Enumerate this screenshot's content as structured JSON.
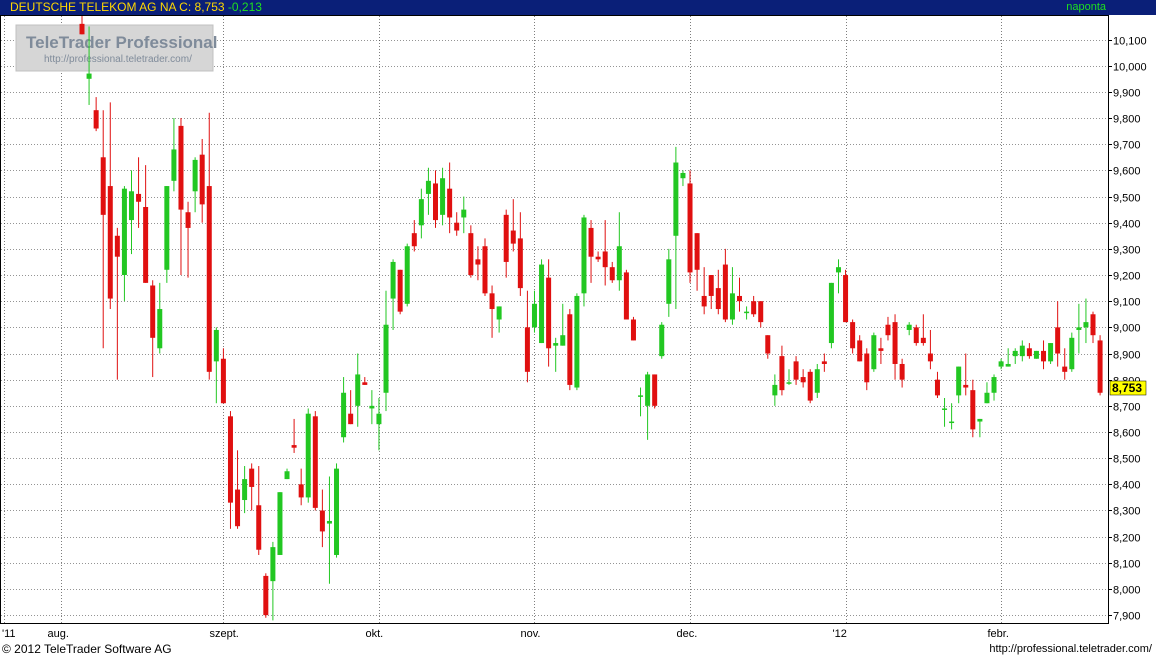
{
  "header": {
    "instrument": "DEUTSCHE TELEKOM AG NA",
    "close_label": "C:",
    "close_value": "8,753",
    "change": "-0,213",
    "period": "naponta"
  },
  "watermark": {
    "brand": "TeleTrader Professional",
    "url": "http://professional.teletrader.com/"
  },
  "last_price_badge": "8,753",
  "footer": {
    "copyright": "© 2012 TeleTrader Software AG",
    "url": "http://professional.teletrader.com/"
  },
  "colors": {
    "up": "#22c722",
    "down": "#e01010",
    "header_bg": "#0a1f78",
    "header_text": "#ffd800",
    "grid": "#2a2a2a",
    "badge": "#ffff00"
  },
  "chart_data": {
    "type": "candlestick",
    "ylim": [
      7.87,
      10.19
    ],
    "yticks": [
      7.9,
      8.0,
      8.1,
      8.2,
      8.3,
      8.4,
      8.5,
      8.6,
      8.7,
      8.8,
      8.9,
      9.0,
      9.1,
      9.2,
      9.3,
      9.4,
      9.5,
      9.6,
      9.7,
      9.8,
      9.9,
      10.0,
      10.1
    ],
    "ytick_labels": [
      "7,900",
      "8,000",
      "8,100",
      "8,200",
      "8,300",
      "8,400",
      "8,500",
      "8,600",
      "8,700",
      "8,800",
      "8,900",
      "9,000",
      "9,100",
      "9,200",
      "9,300",
      "9,400",
      "9,500",
      "9,600",
      "9,700",
      "9,800",
      "9,900",
      "10,000",
      "10,100"
    ],
    "xticks": [
      {
        "label": "'11",
        "index": -11
      },
      {
        "label": "aug.",
        "index": -3
      },
      {
        "label": "szept.",
        "index": 20
      },
      {
        "label": "okt.",
        "index": 42
      },
      {
        "label": "nov.",
        "index": 64
      },
      {
        "label": "dec.",
        "index": 86
      },
      {
        "label": "'12",
        "index": 108
      },
      {
        "label": "febr.",
        "index": 130
      }
    ],
    "candles": [
      {
        "o": 10.16,
        "h": 10.25,
        "l": 10.13,
        "c": 10.12
      },
      {
        "o": 9.95,
        "h": 10.15,
        "l": 9.85,
        "c": 9.97
      },
      {
        "o": 9.83,
        "h": 9.88,
        "l": 9.75,
        "c": 9.76
      },
      {
        "o": 9.65,
        "h": 9.83,
        "l": 8.92,
        "c": 9.43
      },
      {
        "o": 9.54,
        "h": 9.86,
        "l": 9.07,
        "c": 9.11
      },
      {
        "o": 9.35,
        "h": 9.38,
        "l": 8.8,
        "c": 9.27
      },
      {
        "o": 9.2,
        "h": 9.54,
        "l": 9.1,
        "c": 9.53
      },
      {
        "o": 9.41,
        "h": 9.6,
        "l": 9.28,
        "c": 9.52
      },
      {
        "o": 9.51,
        "h": 9.65,
        "l": 9.38,
        "c": 9.48
      },
      {
        "o": 9.46,
        "h": 9.62,
        "l": 9.17,
        "c": 9.17
      },
      {
        "o": 9.16,
        "h": 9.18,
        "l": 8.81,
        "c": 8.96
      },
      {
        "o": 8.92,
        "h": 9.17,
        "l": 8.9,
        "c": 9.07
      },
      {
        "o": 9.22,
        "h": 9.54,
        "l": 9.17,
        "c": 9.54
      },
      {
        "o": 9.56,
        "h": 9.8,
        "l": 9.52,
        "c": 9.68
      },
      {
        "o": 9.77,
        "h": 9.8,
        "l": 9.2,
        "c": 9.45
      },
      {
        "o": 9.44,
        "h": 9.48,
        "l": 9.19,
        "c": 9.38
      },
      {
        "o": 9.52,
        "h": 9.65,
        "l": 9.44,
        "c": 9.64
      },
      {
        "o": 9.66,
        "h": 9.72,
        "l": 9.4,
        "c": 9.47
      },
      {
        "o": 9.54,
        "h": 9.82,
        "l": 8.8,
        "c": 8.83
      },
      {
        "o": 8.87,
        "h": 9.0,
        "l": 8.71,
        "c": 8.99
      },
      {
        "o": 8.88,
        "h": 8.92,
        "l": 8.72,
        "c": 8.71
      },
      {
        "o": 8.66,
        "h": 8.68,
        "l": 8.23,
        "c": 8.33
      },
      {
        "o": 8.38,
        "h": 8.53,
        "l": 8.23,
        "c": 8.24
      },
      {
        "o": 8.34,
        "h": 8.47,
        "l": 8.29,
        "c": 8.42
      },
      {
        "o": 8.46,
        "h": 8.48,
        "l": 8.3,
        "c": 8.39
      },
      {
        "o": 8.32,
        "h": 8.47,
        "l": 8.13,
        "c": 8.15
      },
      {
        "o": 8.05,
        "h": 8.06,
        "l": 7.89,
        "c": 7.9
      },
      {
        "o": 8.03,
        "h": 8.18,
        "l": 7.88,
        "c": 8.16
      },
      {
        "o": 8.13,
        "h": 8.36,
        "l": 8.14,
        "c": 8.37
      },
      {
        "o": 8.42,
        "h": 8.46,
        "l": 8.42,
        "c": 8.45
      },
      {
        "o": 8.55,
        "h": 8.65,
        "l": 8.52,
        "c": 8.54
      },
      {
        "o": 8.4,
        "h": 8.46,
        "l": 8.32,
        "c": 8.35
      },
      {
        "o": 8.35,
        "h": 8.69,
        "l": 8.33,
        "c": 8.67
      },
      {
        "o": 8.66,
        "h": 8.68,
        "l": 8.3,
        "c": 8.31
      },
      {
        "o": 8.3,
        "h": 8.38,
        "l": 8.16,
        "c": 8.22
      },
      {
        "o": 8.25,
        "h": 8.43,
        "l": 8.02,
        "c": 8.26
      },
      {
        "o": 8.13,
        "h": 8.48,
        "l": 8.12,
        "c": 8.46
      },
      {
        "o": 8.58,
        "h": 8.81,
        "l": 8.56,
        "c": 8.75
      },
      {
        "o": 8.67,
        "h": 8.76,
        "l": 8.64,
        "c": 8.63
      },
      {
        "o": 8.7,
        "h": 8.9,
        "l": 8.62,
        "c": 8.82
      },
      {
        "o": 8.79,
        "h": 8.81,
        "l": 8.79,
        "c": 8.78
      },
      {
        "o": 8.69,
        "h": 8.76,
        "l": 8.63,
        "c": 8.7
      },
      {
        "o": 8.63,
        "h": 8.73,
        "l": 8.53,
        "c": 8.67
      },
      {
        "o": 8.75,
        "h": 9.14,
        "l": 8.68,
        "c": 9.01
      },
      {
        "o": 9.11,
        "h": 9.26,
        "l": 8.99,
        "c": 9.25
      },
      {
        "o": 9.22,
        "h": 9.22,
        "l": 9.05,
        "c": 9.06
      },
      {
        "o": 9.09,
        "h": 9.32,
        "l": 9.08,
        "c": 9.31
      },
      {
        "o": 9.36,
        "h": 9.41,
        "l": 9.29,
        "c": 9.31
      },
      {
        "o": 9.39,
        "h": 9.53,
        "l": 9.34,
        "c": 9.49
      },
      {
        "o": 9.51,
        "h": 9.61,
        "l": 9.43,
        "c": 9.56
      },
      {
        "o": 9.55,
        "h": 9.6,
        "l": 9.38,
        "c": 9.41
      },
      {
        "o": 9.43,
        "h": 9.61,
        "l": 9.39,
        "c": 9.57
      },
      {
        "o": 9.53,
        "h": 9.63,
        "l": 9.36,
        "c": 9.42
      },
      {
        "o": 9.4,
        "h": 9.44,
        "l": 9.35,
        "c": 9.37
      },
      {
        "o": 9.42,
        "h": 9.5,
        "l": 9.36,
        "c": 9.45
      },
      {
        "o": 9.36,
        "h": 9.39,
        "l": 9.19,
        "c": 9.2
      },
      {
        "o": 9.26,
        "h": 9.31,
        "l": 9.18,
        "c": 9.24
      },
      {
        "o": 9.31,
        "h": 9.34,
        "l": 9.12,
        "c": 9.13
      },
      {
        "o": 9.13,
        "h": 9.16,
        "l": 8.96,
        "c": 9.07
      },
      {
        "o": 9.03,
        "h": 9.08,
        "l": 8.98,
        "c": 9.08
      },
      {
        "o": 9.43,
        "h": 9.45,
        "l": 9.19,
        "c": 9.25
      },
      {
        "o": 9.37,
        "h": 9.49,
        "l": 9.29,
        "c": 9.32
      },
      {
        "o": 9.34,
        "h": 9.44,
        "l": 9.12,
        "c": 9.15
      },
      {
        "o": 9.0,
        "h": 9.14,
        "l": 8.79,
        "c": 8.83
      },
      {
        "o": 9.0,
        "h": 9.14,
        "l": 8.98,
        "c": 9.09
      },
      {
        "o": 8.94,
        "h": 9.26,
        "l": 8.94,
        "c": 9.24
      },
      {
        "o": 9.19,
        "h": 9.26,
        "l": 8.85,
        "c": 8.92
      },
      {
        "o": 8.93,
        "h": 8.96,
        "l": 8.83,
        "c": 8.94
      },
      {
        "o": 8.93,
        "h": 9.09,
        "l": 8.94,
        "c": 8.97
      },
      {
        "o": 9.05,
        "h": 9.07,
        "l": 8.76,
        "c": 8.78
      },
      {
        "o": 8.77,
        "h": 9.13,
        "l": 8.76,
        "c": 9.12
      },
      {
        "o": 9.13,
        "h": 9.43,
        "l": 9.08,
        "c": 9.42
      },
      {
        "o": 9.38,
        "h": 9.41,
        "l": 9.17,
        "c": 9.27
      },
      {
        "o": 9.27,
        "h": 9.29,
        "l": 9.25,
        "c": 9.26
      },
      {
        "o": 9.29,
        "h": 9.41,
        "l": 9.16,
        "c": 9.23
      },
      {
        "o": 9.23,
        "h": 9.25,
        "l": 9.17,
        "c": 9.18
      },
      {
        "o": 9.18,
        "h": 9.44,
        "l": 9.14,
        "c": 9.31
      },
      {
        "o": 9.21,
        "h": 9.22,
        "l": 9.03,
        "c": 9.03
      },
      {
        "o": 9.03,
        "h": 9.04,
        "l": 8.95,
        "c": 8.95
      },
      {
        "o": 8.74,
        "h": 8.77,
        "l": 8.66,
        "c": 8.74
      },
      {
        "o": 8.7,
        "h": 8.83,
        "l": 8.57,
        "c": 8.82
      },
      {
        "o": 8.82,
        "h": 8.81,
        "l": 8.69,
        "c": 8.7
      },
      {
        "o": 8.89,
        "h": 9.02,
        "l": 8.88,
        "c": 9.01
      },
      {
        "o": 9.09,
        "h": 9.3,
        "l": 9.04,
        "c": 9.26
      },
      {
        "o": 9.35,
        "h": 9.69,
        "l": 9.07,
        "c": 9.63
      },
      {
        "o": 9.57,
        "h": 9.6,
        "l": 9.54,
        "c": 9.59
      },
      {
        "o": 9.55,
        "h": 9.6,
        "l": 9.17,
        "c": 9.21
      },
      {
        "o": 9.36,
        "h": 9.36,
        "l": 9.14,
        "c": 9.22
      },
      {
        "o": 9.12,
        "h": 9.23,
        "l": 9.05,
        "c": 9.08
      },
      {
        "o": 9.2,
        "h": 9.2,
        "l": 9.07,
        "c": 9.12
      },
      {
        "o": 9.15,
        "h": 9.22,
        "l": 9.05,
        "c": 9.07
      },
      {
        "o": 9.24,
        "h": 9.3,
        "l": 9.02,
        "c": 9.03
      },
      {
        "o": 9.03,
        "h": 9.23,
        "l": 9.01,
        "c": 9.13
      },
      {
        "o": 9.12,
        "h": 9.19,
        "l": 9.06,
        "c": 9.1
      },
      {
        "o": 9.06,
        "h": 9.08,
        "l": 9.03,
        "c": 9.06
      },
      {
        "o": 9.1,
        "h": 9.12,
        "l": 9.04,
        "c": 9.05
      },
      {
        "o": 9.1,
        "h": 9.1,
        "l": 9.0,
        "c": 9.02
      },
      {
        "o": 8.97,
        "h": 8.97,
        "l": 8.88,
        "c": 8.9
      },
      {
        "o": 8.74,
        "h": 8.82,
        "l": 8.7,
        "c": 8.78
      },
      {
        "o": 8.89,
        "h": 8.93,
        "l": 8.74,
        "c": 8.76
      },
      {
        "o": 8.79,
        "h": 8.84,
        "l": 8.78,
        "c": 8.79
      },
      {
        "o": 8.87,
        "h": 8.89,
        "l": 8.78,
        "c": 8.8
      },
      {
        "o": 8.81,
        "h": 8.84,
        "l": 8.77,
        "c": 8.79
      },
      {
        "o": 8.83,
        "h": 8.84,
        "l": 8.71,
        "c": 8.72
      },
      {
        "o": 8.75,
        "h": 8.86,
        "l": 8.73,
        "c": 8.84
      },
      {
        "o": 8.87,
        "h": 8.9,
        "l": 8.83,
        "c": 8.86
      },
      {
        "o": 8.94,
        "h": 9.17,
        "l": 8.92,
        "c": 9.17
      },
      {
        "o": 9.21,
        "h": 9.26,
        "l": 9.13,
        "c": 9.23
      },
      {
        "o": 9.2,
        "h": 9.22,
        "l": 9.02,
        "c": 9.02
      },
      {
        "o": 9.02,
        "h": 9.03,
        "l": 8.9,
        "c": 8.92
      },
      {
        "o": 8.95,
        "h": 8.97,
        "l": 8.87,
        "c": 8.87
      },
      {
        "o": 8.9,
        "h": 8.92,
        "l": 8.76,
        "c": 8.79
      },
      {
        "o": 8.84,
        "h": 8.98,
        "l": 8.83,
        "c": 8.97
      },
      {
        "o": 8.92,
        "h": 8.96,
        "l": 8.86,
        "c": 8.91
      },
      {
        "o": 9.01,
        "h": 9.04,
        "l": 8.95,
        "c": 8.97
      },
      {
        "o": 9.02,
        "h": 9.05,
        "l": 8.8,
        "c": 8.86
      },
      {
        "o": 8.86,
        "h": 8.88,
        "l": 8.77,
        "c": 8.8
      },
      {
        "o": 8.99,
        "h": 9.02,
        "l": 8.97,
        "c": 9.01
      },
      {
        "o": 9.0,
        "h": 9.01,
        "l": 8.93,
        "c": 8.94
      },
      {
        "o": 8.96,
        "h": 9.05,
        "l": 8.93,
        "c": 8.94
      },
      {
        "o": 8.9,
        "h": 8.99,
        "l": 8.84,
        "c": 8.87
      },
      {
        "o": 8.8,
        "h": 8.83,
        "l": 8.73,
        "c": 8.74
      },
      {
        "o": 8.69,
        "h": 8.73,
        "l": 8.62,
        "c": 8.69
      },
      {
        "o": 8.64,
        "h": 8.71,
        "l": 8.61,
        "c": 8.64
      },
      {
        "o": 8.74,
        "h": 8.85,
        "l": 8.71,
        "c": 8.85
      },
      {
        "o": 8.78,
        "h": 8.9,
        "l": 8.74,
        "c": 8.77
      },
      {
        "o": 8.76,
        "h": 8.8,
        "l": 8.58,
        "c": 8.61
      },
      {
        "o": 8.64,
        "h": 8.65,
        "l": 8.58,
        "c": 8.65
      },
      {
        "o": 8.71,
        "h": 8.79,
        "l": 8.71,
        "c": 8.75
      },
      {
        "o": 8.75,
        "h": 8.82,
        "l": 8.72,
        "c": 8.81
      },
      {
        "o": 8.85,
        "h": 8.88,
        "l": 8.84,
        "c": 8.87
      },
      {
        "o": 8.85,
        "h": 8.92,
        "l": 8.85,
        "c": 8.86
      },
      {
        "o": 8.89,
        "h": 8.92,
        "l": 8.86,
        "c": 8.91
      },
      {
        "o": 8.89,
        "h": 8.95,
        "l": 8.87,
        "c": 8.93
      },
      {
        "o": 8.92,
        "h": 8.94,
        "l": 8.88,
        "c": 8.89
      },
      {
        "o": 8.88,
        "h": 8.91,
        "l": 8.88,
        "c": 8.91
      },
      {
        "o": 8.91,
        "h": 8.95,
        "l": 8.84,
        "c": 8.87
      },
      {
        "o": 8.87,
        "h": 8.94,
        "l": 8.86,
        "c": 8.94
      },
      {
        "o": 9.0,
        "h": 9.1,
        "l": 8.85,
        "c": 8.9
      },
      {
        "o": 8.85,
        "h": 8.92,
        "l": 8.8,
        "c": 8.83
      },
      {
        "o": 8.84,
        "h": 8.98,
        "l": 8.83,
        "c": 8.96
      },
      {
        "o": 8.99,
        "h": 9.09,
        "l": 8.9,
        "c": 9.0
      },
      {
        "o": 9.0,
        "h": 9.11,
        "l": 8.94,
        "c": 9.02
      },
      {
        "o": 9.05,
        "h": 9.06,
        "l": 8.94,
        "c": 8.97
      },
      {
        "o": 8.95,
        "h": 8.97,
        "l": 8.74,
        "c": 8.75
      }
    ]
  }
}
